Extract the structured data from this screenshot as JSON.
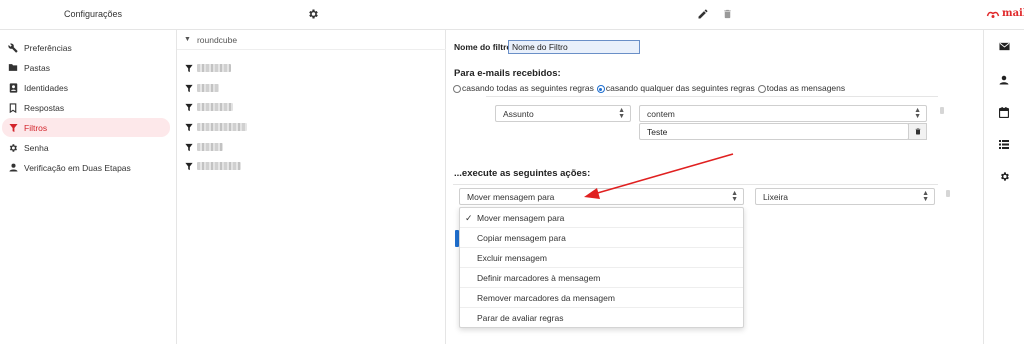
{
  "header": {
    "title": "Configurações",
    "logo_text": "mailo",
    "brand_color": "#e0282a"
  },
  "leftnav": {
    "items": [
      {
        "label": "Preferências",
        "icon": "wrench-icon"
      },
      {
        "label": "Pastas",
        "icon": "folder-icon"
      },
      {
        "label": "Identidades",
        "icon": "id-card-icon"
      },
      {
        "label": "Respostas",
        "icon": "bookmark-icon"
      },
      {
        "label": "Filtros",
        "icon": "filter-icon",
        "active": true
      },
      {
        "label": "Senha",
        "icon": "gear-icon"
      },
      {
        "label": "Verificação em Duas Etapas",
        "icon": "user-icon"
      }
    ],
    "active_color": "#d3242b"
  },
  "filters": {
    "set_name": "roundcube",
    "items": [
      "filtro-1",
      "filtro-2",
      "filtro-3",
      "filtro-4",
      "filtro-5",
      "filtro-6"
    ]
  },
  "form": {
    "name_label": "Nome do filtro:",
    "name_value": "Nome do Filtro",
    "incoming_heading": "Para e-mails recebidos:",
    "radio_all_rules": "casando todas as seguintes regras",
    "radio_any_rule": "casando qualquer das seguintes regras",
    "radio_all_messages": "todas as mensagens",
    "selected_radio": "casando qualquer das seguintes regras",
    "rule_header": "Assunto",
    "rule_operator": "contem",
    "rule_value": "Teste",
    "actions_heading": "...execute as seguintes ações:",
    "action_selected": "Mover mensagem para",
    "action_target": "Lixeira",
    "action_options": [
      "Mover mensagem para",
      "Copiar mensagem para",
      "Excluir mensagem",
      "Definir marcadores à mensagem",
      "Remover marcadores da mensagem",
      "Parar de avaliar regras"
    ],
    "accent_color": "#1f6fd0"
  },
  "rail": {
    "icons": [
      "mail-icon",
      "contacts-icon",
      "calendar-icon",
      "list-icon",
      "settings-icon"
    ]
  },
  "annotation": {
    "arrow_color": "#e02020"
  }
}
